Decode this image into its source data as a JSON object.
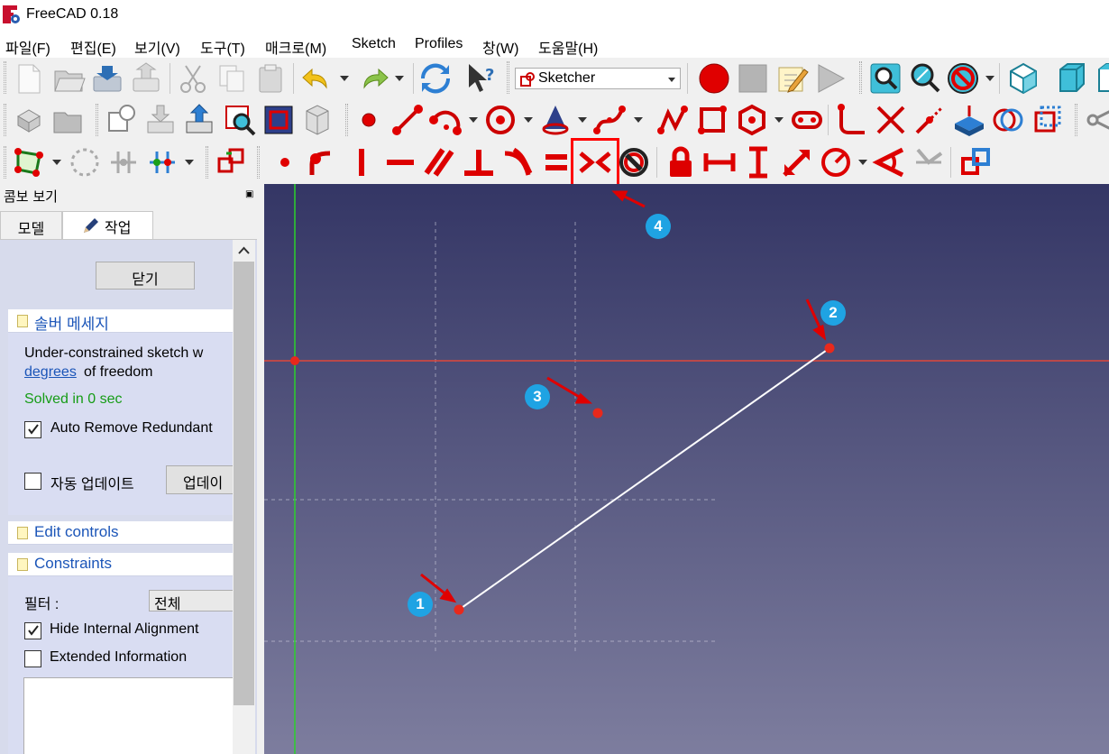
{
  "window": {
    "title": "FreeCAD 0.18"
  },
  "menubar": {
    "items": [
      "파일(F)",
      "편집(E)",
      "보기(V)",
      "도구(T)",
      "매크로(M)",
      "Sketch",
      "Profiles",
      "창(W)",
      "도움말(H)"
    ]
  },
  "toolbar": {
    "workbench": "Sketcher",
    "highlighted_tool": "constrain-symmetric-icon"
  },
  "panel": {
    "title": "콤보 보기",
    "tabs": [
      "모델",
      "작업"
    ],
    "close_button": "닫기",
    "solver": {
      "header": "솔버 메세지",
      "line1": "Under-constrained sketch w",
      "link": "degrees",
      "line2_rest": " of freedom",
      "solved": "Solved in 0 sec",
      "auto_remove": "Auto Remove Redundant",
      "auto_remove_checked": true,
      "auto_update": "자동 업데이트",
      "auto_update_checked": false,
      "update_button": "업데이"
    },
    "edit_controls": {
      "header": "Edit controls"
    },
    "constraints": {
      "header": "Constraints",
      "filter_label": "필터 :",
      "filter_value": "전체",
      "hide_internal": "Hide Internal Alignment",
      "hide_internal_checked": true,
      "extended_info": "Extended Information",
      "extended_info_checked": false
    }
  },
  "annotations": {
    "badges": [
      "1",
      "2",
      "3",
      "4"
    ]
  },
  "colors": {
    "accent": "#e00000",
    "badge": "#1fa3e3",
    "link": "#1b55b8",
    "solved": "#169c16",
    "axis_x": "#e0463a",
    "axis_y": "#2bd12b"
  }
}
